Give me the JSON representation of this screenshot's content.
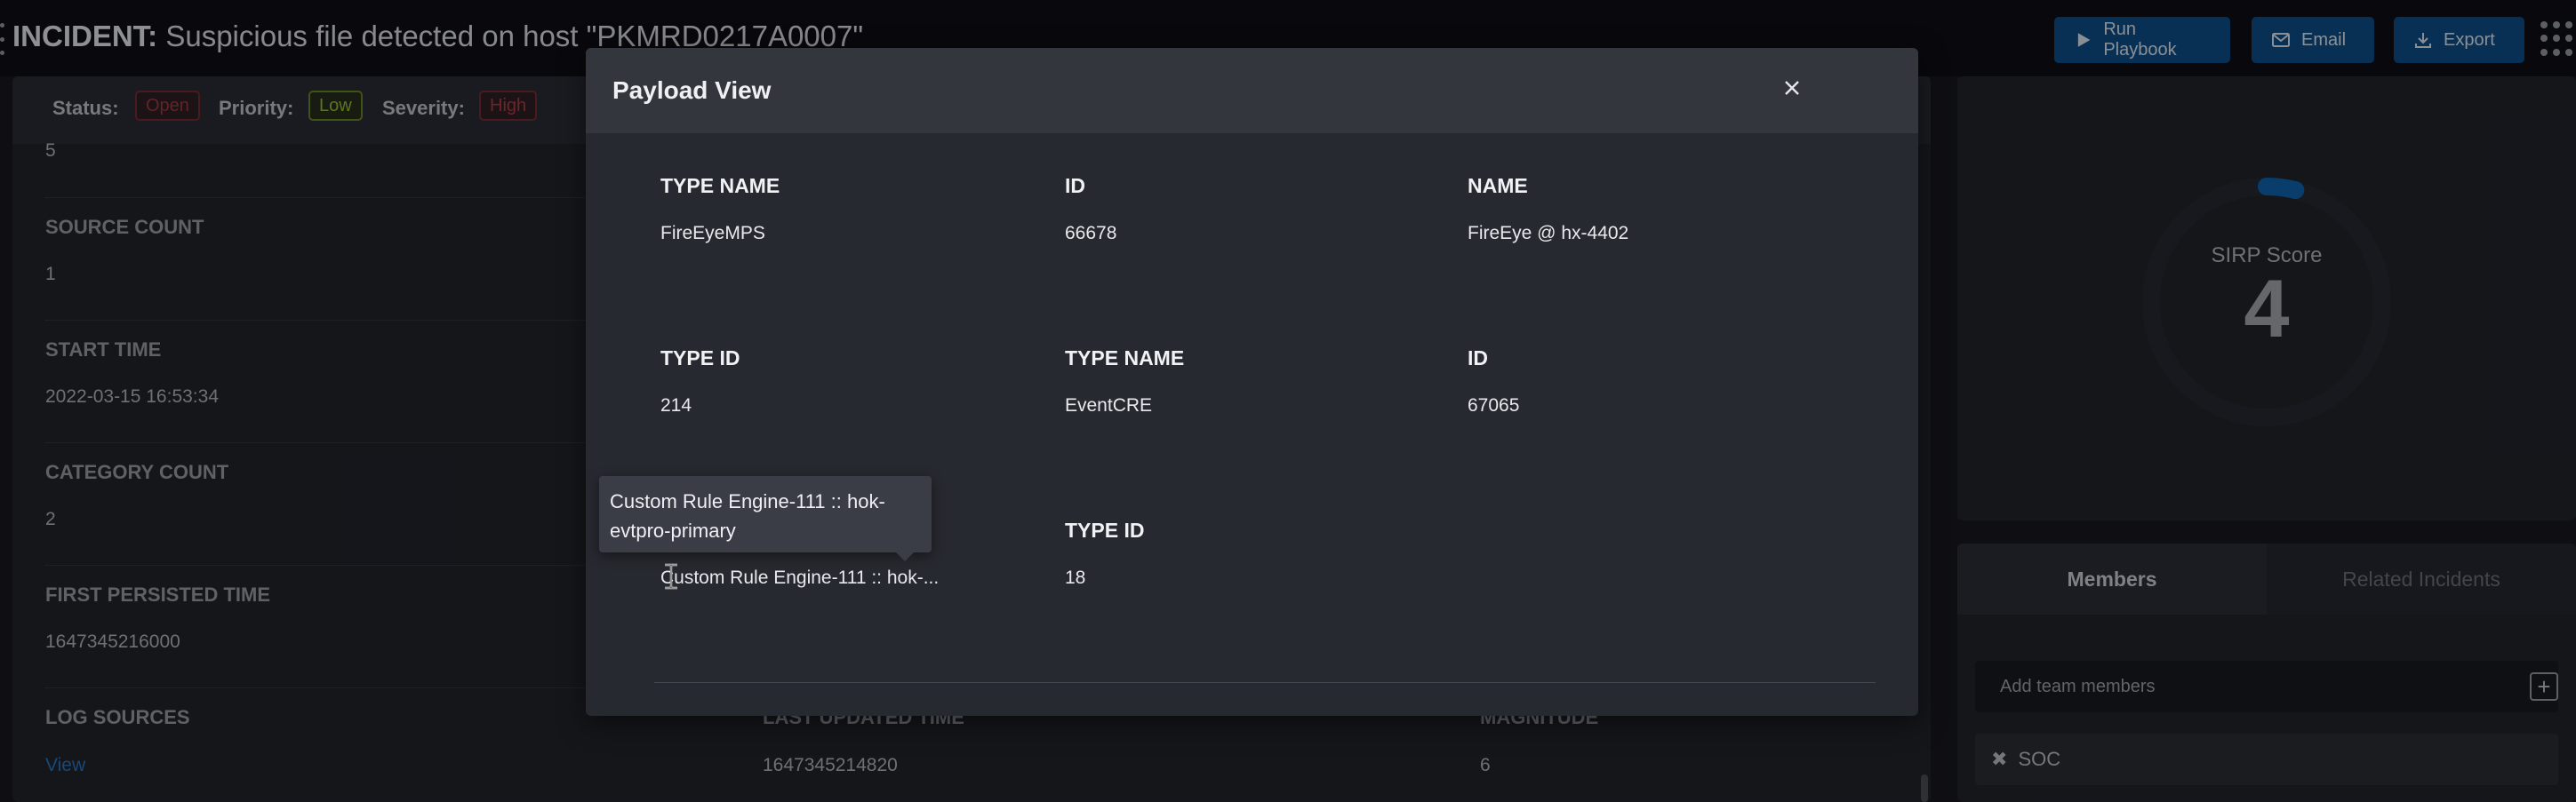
{
  "header": {
    "title_prefix": "INCIDENT:",
    "title_text": "Suspicious file detected on host \"PKMRD0217A0007\"",
    "buttons": {
      "run_playbook": "Run Playbook",
      "email": "Email",
      "export": "Export"
    }
  },
  "status_bar": {
    "status_label": "Status:",
    "status_value": "Open",
    "priority_label": "Priority:",
    "priority_value": "Low",
    "severity_label": "Severity:",
    "severity_value": "High"
  },
  "details": {
    "partial_value": "5",
    "source_count_label": "SOURCE COUNT",
    "source_count_value": "1",
    "start_time_label": "START TIME",
    "start_time_value": "2022-03-15 16:53:34",
    "category_count_label": "CATEGORY COUNT",
    "category_count_value": "2",
    "first_persisted_label": "FIRST PERSISTED TIME",
    "first_persisted_value": "1647345216000",
    "log_sources_label": "LOG SOURCES",
    "log_sources_link": "View",
    "last_updated_label": "LAST UPDATED TIME",
    "last_updated_value": "1647345214820",
    "magnitude_label": "MAGNITUDE",
    "magnitude_value": "6"
  },
  "score": {
    "label": "SIRP Score",
    "value": "4",
    "fraction": 0.04,
    "accent": "#0a64b4"
  },
  "members": {
    "tab_members": "Members",
    "tab_related": "Related Incidents",
    "add_placeholder": "Add team members",
    "chips": [
      "SOC"
    ]
  },
  "modal": {
    "title": "Payload View",
    "rows": [
      [
        {
          "label": "TYPE NAME",
          "value": "FireEyeMPS"
        },
        {
          "label": "ID",
          "value": "66678"
        },
        {
          "label": "NAME",
          "value": "FireEye @ hx-4402"
        }
      ],
      [
        {
          "label": "TYPE ID",
          "value": "214"
        },
        {
          "label": "TYPE NAME",
          "value": "EventCRE"
        },
        {
          "label": "ID",
          "value": "67065"
        }
      ],
      [
        {
          "label": "",
          "value": "Custom Rule Engine-111 :: hok-..."
        },
        {
          "label": "TYPE ID",
          "value": "18"
        }
      ]
    ],
    "tooltip": "Custom Rule Engine-111 :: hok-evtpro-primary"
  },
  "colors": {
    "primary_button": "#0a4f8a",
    "link": "#2577c8",
    "status_open": "#a33a3f",
    "priority_low": "#9cc535",
    "severity_high": "#b53c42"
  }
}
